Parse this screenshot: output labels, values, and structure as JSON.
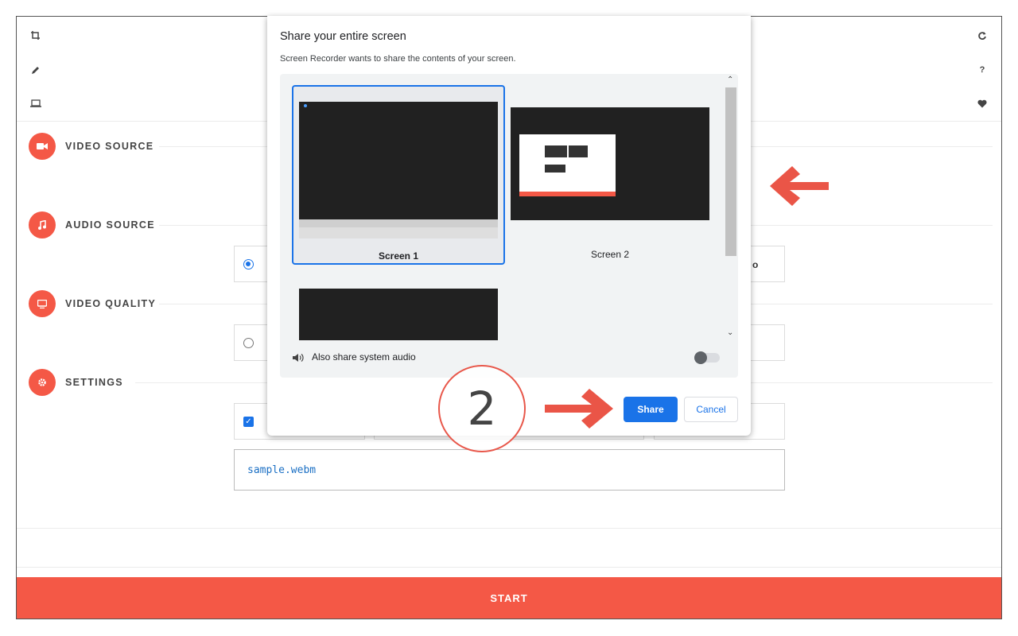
{
  "toolbar": {
    "left_icons": [
      "crop-icon",
      "pencil-icon",
      "laptop-icon"
    ],
    "right_icons": [
      "refresh-icon",
      "help-icon",
      "heart-icon"
    ]
  },
  "sections": [
    {
      "label": "VIDEO SOURCE",
      "icon": "video-camera-icon"
    },
    {
      "label": "AUDIO SOURCE",
      "icon": "music-note-icon"
    },
    {
      "label": "VIDEO QUALITY",
      "icon": "monitor-icon"
    },
    {
      "label": "SETTINGS",
      "icon": "gear-icon"
    }
  ],
  "audio_option_partial": "o",
  "settings": {
    "filename": "sample.webm"
  },
  "start_button": "START",
  "dialog": {
    "title": "Share your entire screen",
    "subtitle": "Screen Recorder wants to share the contents of your screen.",
    "screens": [
      {
        "label": "Screen 1",
        "selected": true
      },
      {
        "label": "Screen 2",
        "selected": false
      }
    ],
    "audio_label": "Also share system audio",
    "audio_enabled": false,
    "share_button": "Share",
    "cancel_button": "Cancel"
  },
  "annotation": {
    "step_number": "2",
    "accent_color": "#e8574a"
  },
  "colors": {
    "accent": "#f45846",
    "primary_blue": "#1a73e8"
  }
}
